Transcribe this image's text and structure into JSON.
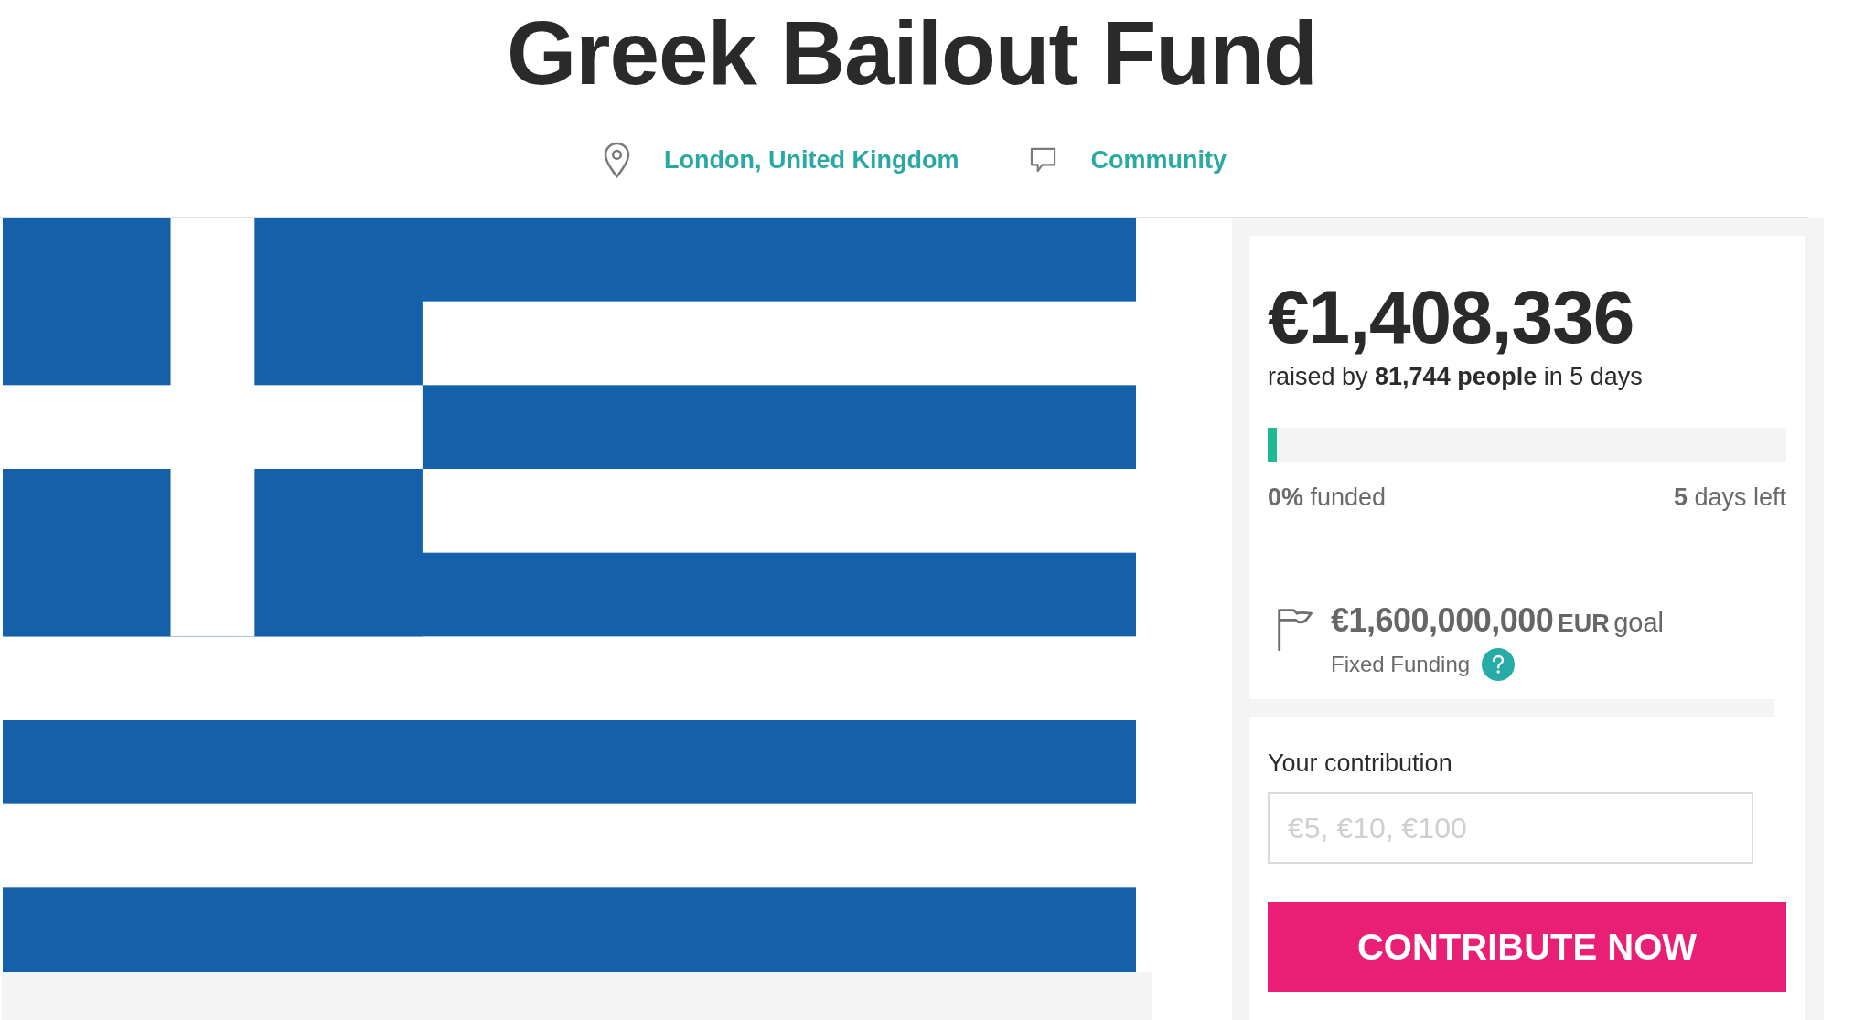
{
  "title": "Greek Bailout Fund",
  "meta": [
    {
      "kind": "location",
      "label": "London, United Kingdom"
    },
    {
      "kind": "category",
      "label": "Community"
    }
  ],
  "funding": {
    "amount": "€1,408,336",
    "raised_text": "raised by **81,744 people** in 5 days",
    "progress": {
      "level": 0.018
    },
    "funded": "**0%** funded",
    "time_left": "**5** days left",
    "goal": {
      "amount": "€1,600,000,000",
      "currency": "EUR",
      "label": "goal",
      "type": "Fixed Funding"
    }
  },
  "contribution": {
    "label": "Your contribution",
    "placeholder": "€5, €10, €100",
    "button": "CONTRIBUTE NOW"
  }
}
